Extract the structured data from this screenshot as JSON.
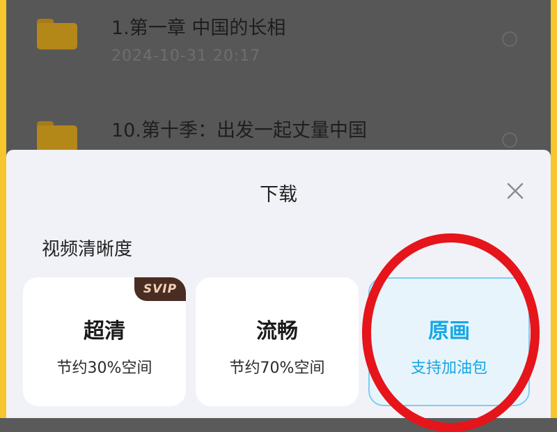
{
  "files": [
    {
      "name": "1.第一章 中国的长相",
      "date": "2024-10-31  20:17"
    },
    {
      "name": "10.第十季：出发一起丈量中国",
      "date": ""
    }
  ],
  "sheet": {
    "title": "下载",
    "section_label": "视频清晰度",
    "options": [
      {
        "name": "超清",
        "desc": "节约30%空间",
        "badge": "SVIP"
      },
      {
        "name": "流畅",
        "desc": "节约70%空间"
      },
      {
        "name": "原画",
        "desc": "支持加油包",
        "selected": true
      }
    ]
  },
  "icons": {
    "close": "close-icon",
    "folder": "folder-icon",
    "radio": "radio-circle-icon"
  },
  "colors": {
    "accent": "#15a6e6",
    "highlight_ring": "#e6141b",
    "frame": "#f7c52c",
    "badge_bg": "#4a2d22"
  }
}
